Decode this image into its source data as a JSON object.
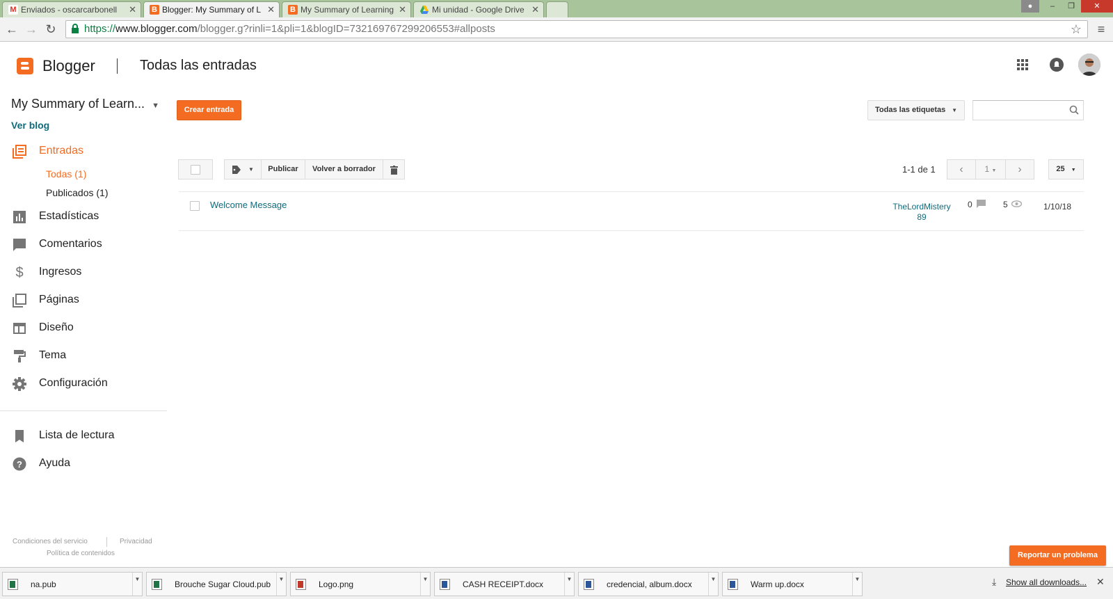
{
  "browser": {
    "tabs": [
      {
        "title": "Enviados - oscarcarbonell",
        "icon": "gmail-icon"
      },
      {
        "title": "Blogger: My Summary of L",
        "icon": "blogger-icon",
        "active": true
      },
      {
        "title": "My Summary of Learning",
        "icon": "blogger-icon"
      },
      {
        "title": "Mi unidad - Google Drive",
        "icon": "drive-icon"
      }
    ],
    "url_scheme": "https://",
    "url_host": "www.blogger.com",
    "url_path": "/blogger.g?rinli=1&pli=1&blogID=732169767299206553#allposts"
  },
  "header": {
    "brand": "Blogger",
    "page_title": "Todas las entradas"
  },
  "sidebar": {
    "blog_name": "My Summary of Learn...",
    "view_blog": "Ver blog",
    "posts_label": "Entradas",
    "sub_all": "Todas (1)",
    "sub_published": "Publicados (1)",
    "items": [
      {
        "label": "Estadísticas",
        "icon": "stats-icon"
      },
      {
        "label": "Comentarios",
        "icon": "comment-icon"
      },
      {
        "label": "Ingresos",
        "icon": "dollar-icon"
      },
      {
        "label": "Páginas",
        "icon": "pages-icon"
      },
      {
        "label": "Diseño",
        "icon": "layout-icon"
      },
      {
        "label": "Tema",
        "icon": "paint-roller-icon"
      },
      {
        "label": "Configuración",
        "icon": "gear-icon"
      }
    ],
    "reading_list": "Lista de lectura",
    "help": "Ayuda",
    "footer": {
      "terms": "Condiciones del servicio",
      "privacy": "Privacidad",
      "content_policy": "Política de contenidos"
    }
  },
  "main": {
    "new_post": "Crear entrada",
    "labels_filter": "Todas las etiquetas",
    "publish": "Publicar",
    "revert_draft": "Volver a borrador",
    "range": "1-1 de 1",
    "page": "1",
    "per_page": "25",
    "posts": [
      {
        "title": "Welcome Message",
        "author_line1": "TheLordMistery",
        "author_line2": "89",
        "comments": "0",
        "views": "5",
        "date": "1/10/18"
      }
    ],
    "report": "Reportar un problema"
  },
  "downloads": {
    "items": [
      {
        "name": "na.pub",
        "color": "#217346"
      },
      {
        "name": "Brouche Sugar Cloud.pub",
        "color": "#217346"
      },
      {
        "name": "Logo.png",
        "color": "#c0392b"
      },
      {
        "name": "CASH RECEIPT.docx",
        "color": "#2b579a"
      },
      {
        "name": "credencial, album.docx",
        "color": "#2b579a"
      },
      {
        "name": "Warm up.docx",
        "color": "#2b579a"
      }
    ],
    "show_all": "Show all downloads..."
  },
  "colors": {
    "accent": "#f36c21",
    "link": "#0d6b7c"
  }
}
